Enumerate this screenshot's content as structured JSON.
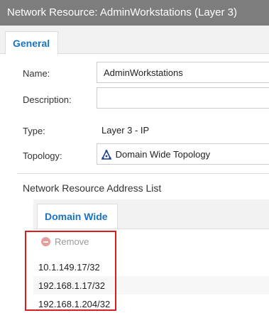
{
  "window": {
    "title": "Network Resource: AdminWorkstations (Layer 3)"
  },
  "tabs": {
    "general_label": "General"
  },
  "form": {
    "name_label": "Name:",
    "name_value": "AdminWorkstations",
    "description_label": "Description:",
    "description_value": "",
    "type_label": "Type:",
    "type_value": "Layer 3 - IP",
    "topology_label": "Topology:",
    "topology_value": "Domain Wide Topology",
    "topology_icon": "topology-triangle-icon"
  },
  "address_list": {
    "section_title": "Network Resource Address List",
    "tab_label": "Domain Wide",
    "remove_label": "Remove",
    "remove_icon": "minus-circle-icon",
    "rows": [
      "10.1.149.17/32",
      "192.168.1.17/32",
      "192.168.1.204/32"
    ]
  },
  "colors": {
    "titlebar": "#7d7d7d",
    "tab_text": "#1a74c0",
    "highlight_border": "#d81e1e"
  }
}
